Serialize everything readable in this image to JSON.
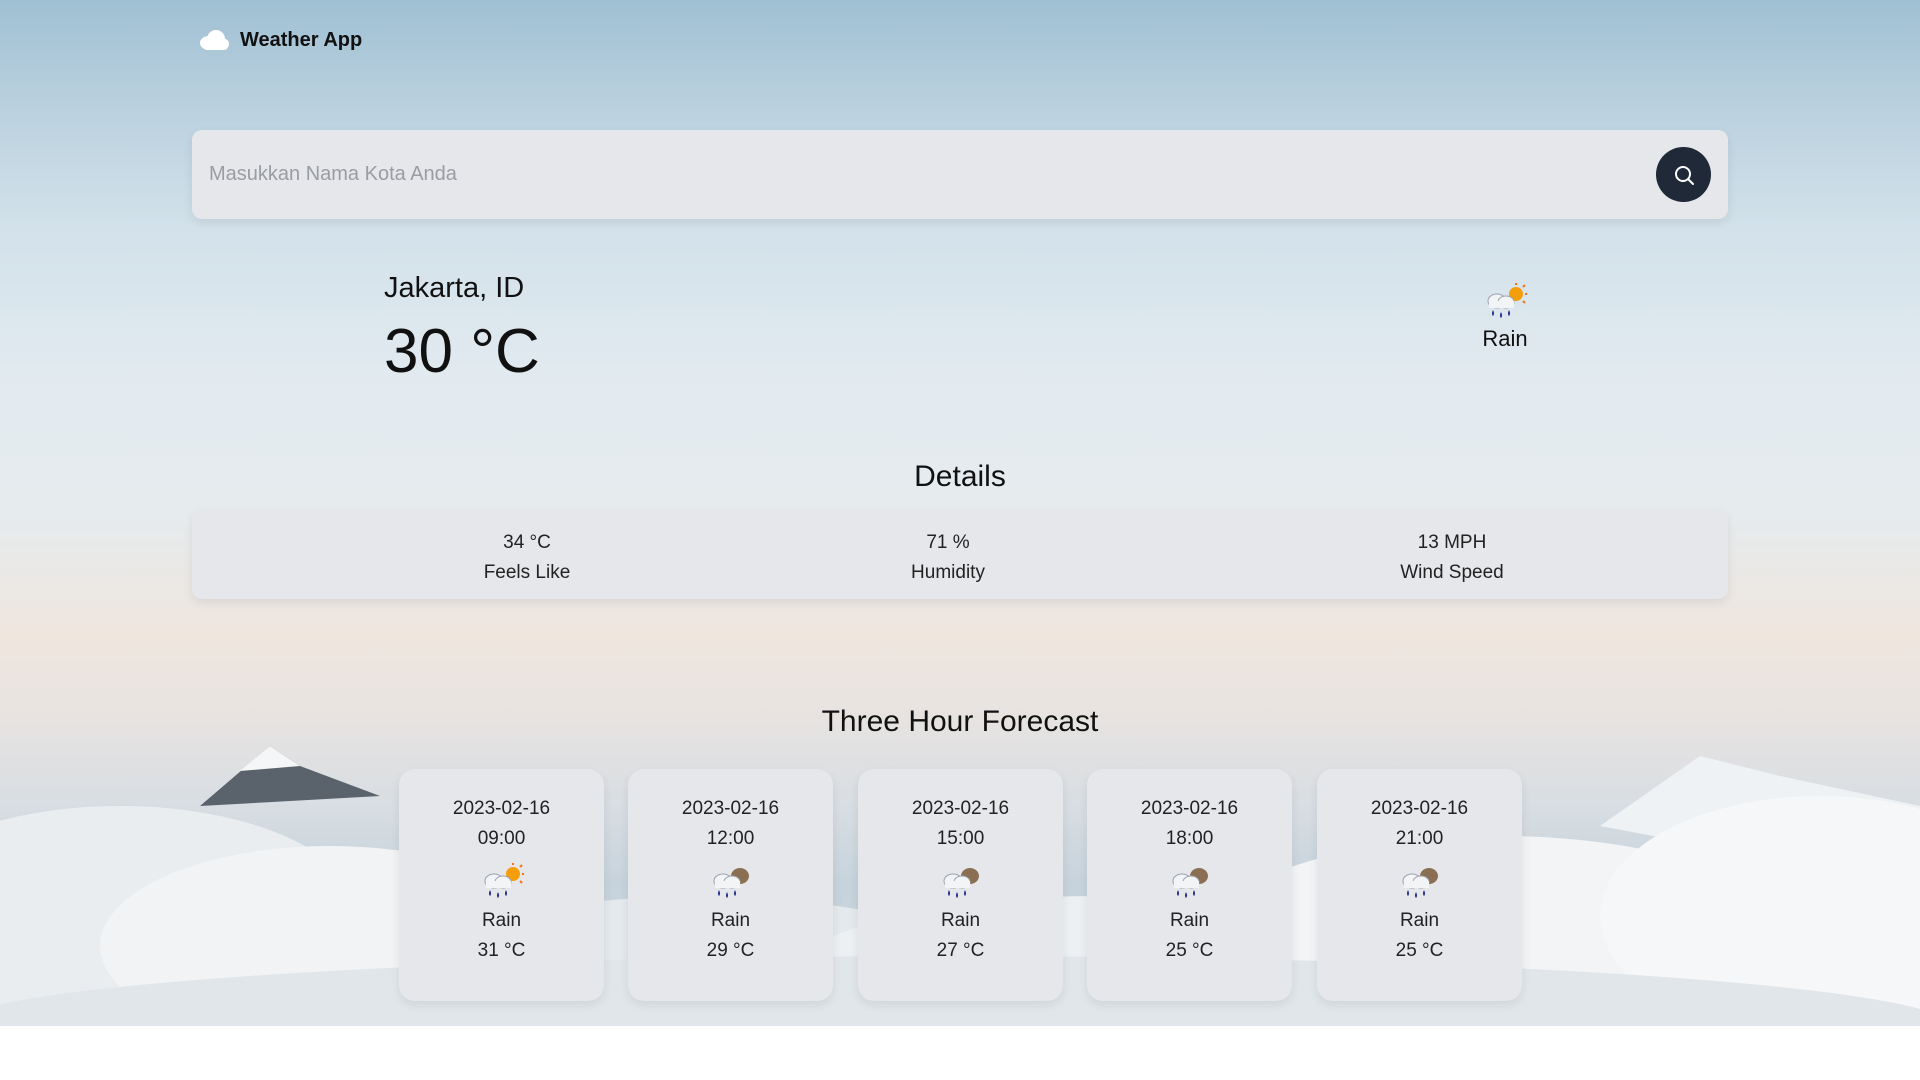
{
  "app": {
    "title": "Weather App",
    "logo_icon": "cloud-icon"
  },
  "search": {
    "placeholder": "Masukkan Nama Kota Anda",
    "value": "",
    "button_icon": "search-icon"
  },
  "current": {
    "city": "Jakarta, ID",
    "temperature": "30 °C",
    "condition": "Rain",
    "icon": "rain-sun-icon"
  },
  "details": {
    "title": "Details",
    "items": [
      {
        "value": "34 °C",
        "label": "Feels Like"
      },
      {
        "value": "71 %",
        "label": "Humidity"
      },
      {
        "value": "13 MPH",
        "label": "Wind Speed"
      }
    ]
  },
  "forecast": {
    "title": "Three Hour Forecast",
    "items": [
      {
        "date": "2023-02-16",
        "time": "09:00",
        "condition": "Rain",
        "temp": "31 °C",
        "icon": "rain-sun-icon"
      },
      {
        "date": "2023-02-16",
        "time": "12:00",
        "condition": "Rain",
        "temp": "29 °C",
        "icon": "rain-cloud-icon"
      },
      {
        "date": "2023-02-16",
        "time": "15:00",
        "condition": "Rain",
        "temp": "27 °C",
        "icon": "rain-cloud-icon"
      },
      {
        "date": "2023-02-16",
        "time": "18:00",
        "condition": "Rain",
        "temp": "25 °C",
        "icon": "rain-cloud-icon"
      },
      {
        "date": "2023-02-16",
        "time": "21:00",
        "condition": "Rain",
        "temp": "25 °C",
        "icon": "rain-cloud-icon"
      }
    ]
  },
  "colors": {
    "card_bg": "#e5e7eb",
    "search_button": "#1f2937",
    "rain_drops": "#1e2a8a",
    "sun": "#f59e0b"
  }
}
